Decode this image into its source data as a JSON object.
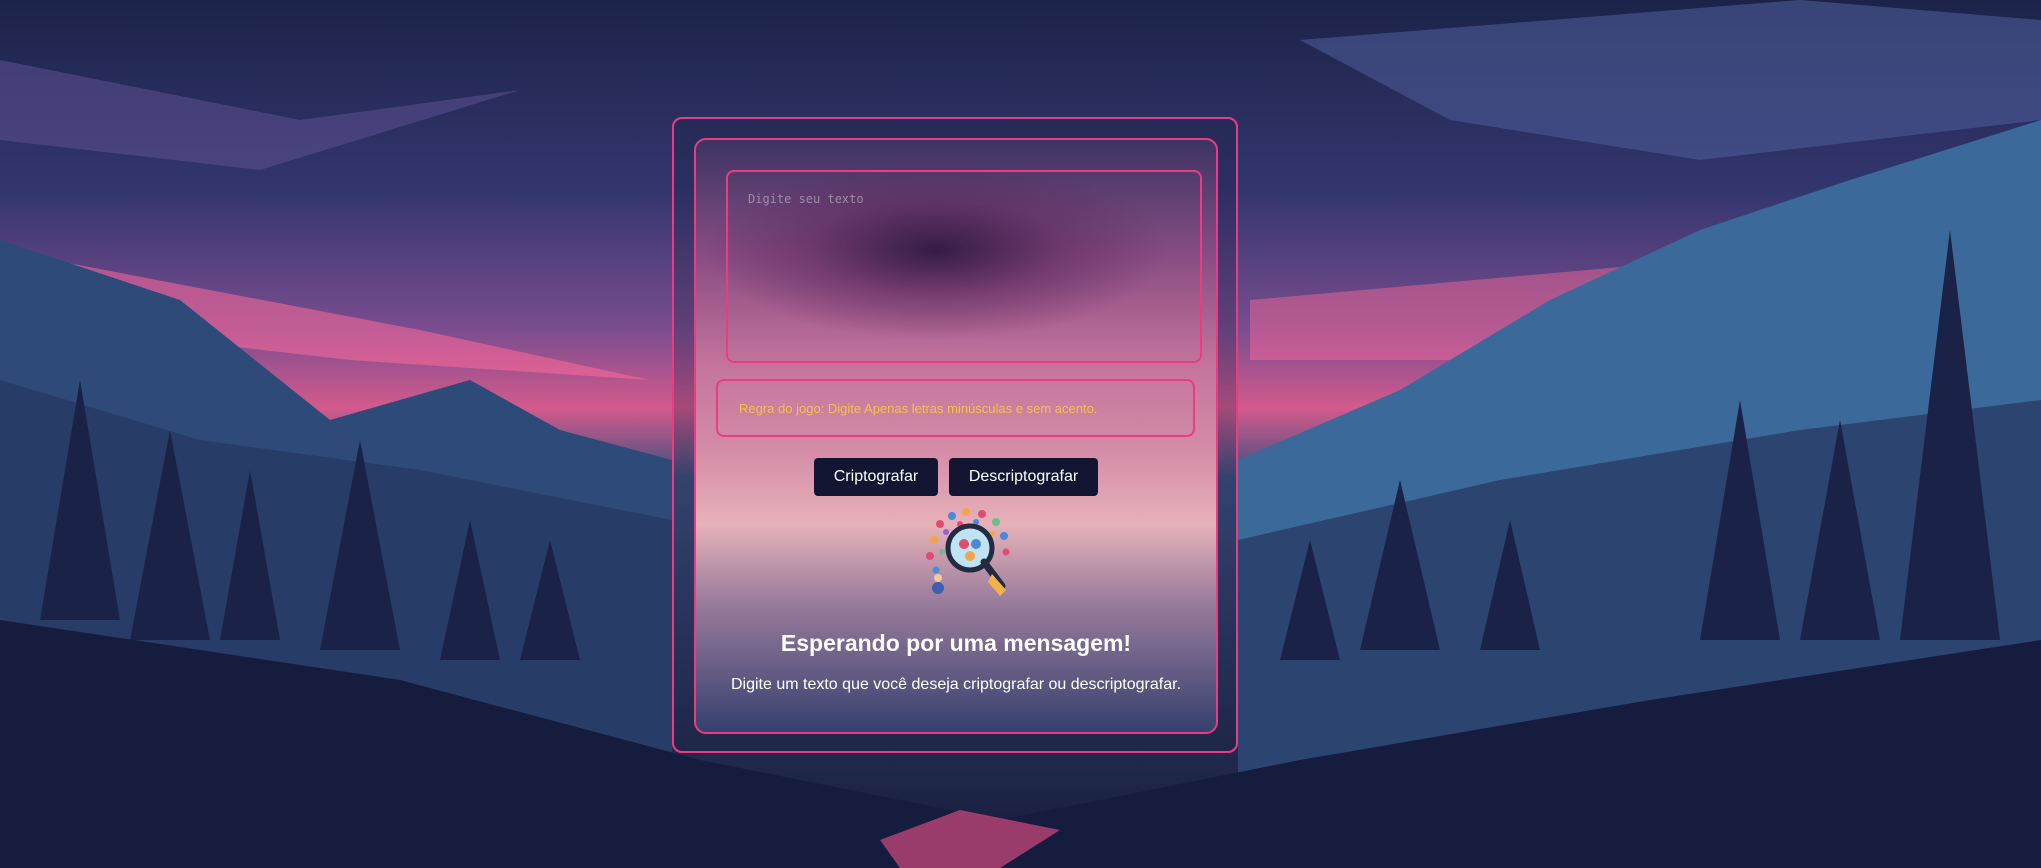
{
  "input": {
    "placeholder": "Digite seu texto",
    "value": ""
  },
  "rule": {
    "text": "Regra do jogo: Digite Apenas letras minúsculas e sem acento."
  },
  "buttons": {
    "encrypt_label": "Criptografar",
    "decrypt_label": "Descriptografar"
  },
  "status": {
    "title": "Esperando por uma mensagem!",
    "description": "Digite um texto que você deseja criptografar ou descriptografar."
  },
  "icons": {
    "illustration": "magnifying-glass-illustration-icon"
  },
  "colors": {
    "accent_border": "#e93d83",
    "button_bg": "#121632",
    "rule_text": "#f5c14a",
    "text": "#ffffff"
  }
}
